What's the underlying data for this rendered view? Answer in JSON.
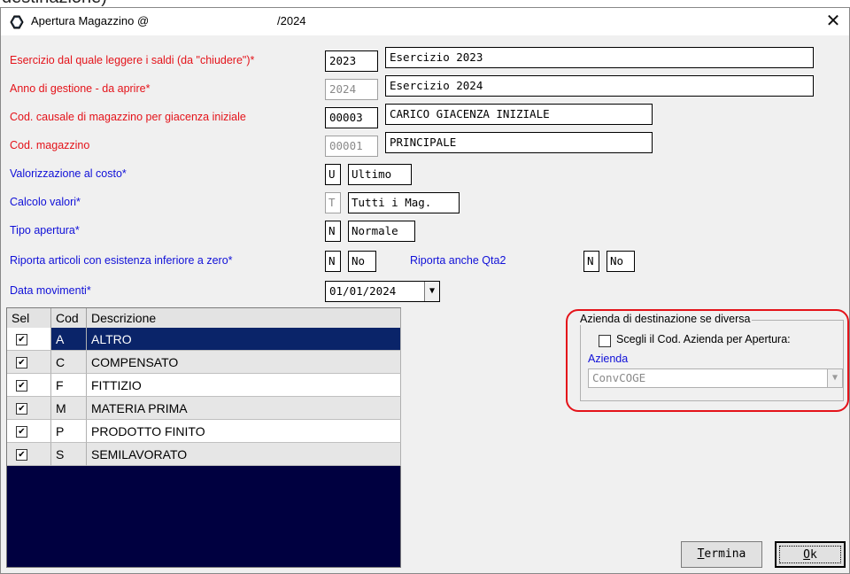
{
  "clipped_caption": "destinazione)",
  "window": {
    "title": "Apertura Magazzino @",
    "title_year": "/2024",
    "close_glyph": "✕"
  },
  "form": {
    "esercizio_label": "Esercizio dal quale leggere i saldi (da \"chiudere\")*",
    "esercizio_code": "2023",
    "esercizio_desc": "Esercizio 2023",
    "anno_label": "Anno di gestione - da aprire*",
    "anno_code": "2024",
    "anno_desc": "Esercizio 2024",
    "causale_label": "Cod. causale di  magazzino per giacenza iniziale",
    "causale_code": "00003",
    "causale_desc": "CARICO GIACENZA INIZIALE",
    "magazzino_label": "Cod. magazzino",
    "magazzino_code": "00001",
    "magazzino_desc": "PRINCIPALE",
    "valorizzazione_label": "Valorizzazione al costo*",
    "valorizzazione_code": "U",
    "valorizzazione_desc": "Ultimo",
    "calcolo_label": "Calcolo valori*",
    "calcolo_code": "T",
    "calcolo_desc": "Tutti i Mag.",
    "tipo_label": "Tipo apertura*",
    "tipo_code": "N",
    "tipo_desc": "Normale",
    "riporta_label": "Riporta articoli con esistenza inferiore a zero*",
    "riporta_code": "N",
    "riporta_desc": "No",
    "qta2_label": "Riporta anche Qta2",
    "qta2_code": "N",
    "qta2_desc": "No",
    "data_label": "Data movimenti*",
    "data_value": "01/01/2024"
  },
  "grid": {
    "headers": [
      "Sel",
      "Cod",
      "Descrizione"
    ],
    "rows": [
      {
        "sel": "✔",
        "cod": "A",
        "desc": "ALTRO"
      },
      {
        "sel": "✔",
        "cod": "C",
        "desc": "COMPENSATO"
      },
      {
        "sel": "✔",
        "cod": "F",
        "desc": "FITTIZIO"
      },
      {
        "sel": "✔",
        "cod": "M",
        "desc": "MATERIA PRIMA"
      },
      {
        "sel": "✔",
        "cod": "P",
        "desc": "PRODOTTO FINITO"
      },
      {
        "sel": "✔",
        "cod": "S",
        "desc": "SEMILAVORATO"
      }
    ],
    "selected_row": "A"
  },
  "azienda_group": {
    "title": "Azienda di destinazione se diversa",
    "checkbox_label": "Scegli il Cod. Azienda per Apertura:",
    "azienda_label": "Azienda",
    "azienda_value": "ConvCOGE"
  },
  "buttons": {
    "termina_first": "T",
    "termina_rest": "ermina",
    "ok_first": "O",
    "ok_rest": "k"
  },
  "colors": {
    "required_label": "#e4131a",
    "optional_label": "#1010d8",
    "grid_bg": "#000040",
    "selected_row": "#0a2469",
    "highlight_circle": "#e4131a"
  }
}
